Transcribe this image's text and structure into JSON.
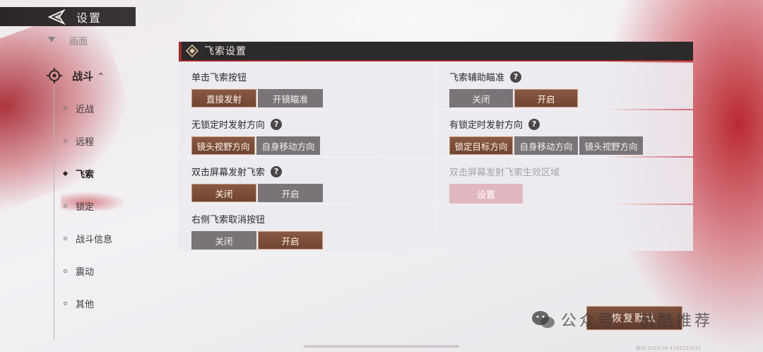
{
  "header": {
    "title": "设置"
  },
  "sidebar": {
    "top_item": "画面",
    "group": {
      "label": "战斗",
      "arrow": "^"
    },
    "items": [
      {
        "label": "近战"
      },
      {
        "label": "远程"
      },
      {
        "label": "飞索",
        "active": true
      },
      {
        "label": "锁定"
      },
      {
        "label": "战斗信息"
      },
      {
        "label": "震动"
      },
      {
        "label": "其他"
      }
    ]
  },
  "panel": {
    "title": "飞索设置",
    "settings": [
      {
        "label": "单击飞索按钮",
        "help": false,
        "options": [
          "直接发射",
          "开镜瞄准"
        ],
        "selected": 0
      },
      {
        "label": "飞索辅助瞄准",
        "help": true,
        "options": [
          "关闭",
          "开启"
        ],
        "selected": 1
      },
      {
        "label": "无锁定时发射方向",
        "help": true,
        "options": [
          "镜头视野方向",
          "自身移动方向"
        ],
        "selected": 0
      },
      {
        "label": "有锁定时发射方向",
        "help": true,
        "options": [
          "锁定目标方向",
          "自身移动方向",
          "镜头视野方向"
        ],
        "selected": 0
      },
      {
        "label": "双击屏幕发射飞索",
        "help": true,
        "options": [
          "关闭",
          "开启"
        ],
        "selected": 0
      },
      {
        "label": "双击屏幕发射飞索生效区域",
        "disabled": true,
        "button": "设置"
      },
      {
        "label": "右侧飞索取消按钮",
        "help": false,
        "options": [
          "关闭",
          "开启"
        ],
        "selected": 1
      }
    ],
    "help_glyph": "?"
  },
  "footer": {
    "reset_label": "恢复默认",
    "watermark": "公众号 · 玩酷推荐",
    "footnote": "版号:2024-04-1182231631"
  },
  "colors": {
    "accent_selected": "#7e4f3a",
    "option_unselected": "#7a7479",
    "header_bg": "#2d2a2c",
    "accent_red": "#9e2b2b"
  }
}
